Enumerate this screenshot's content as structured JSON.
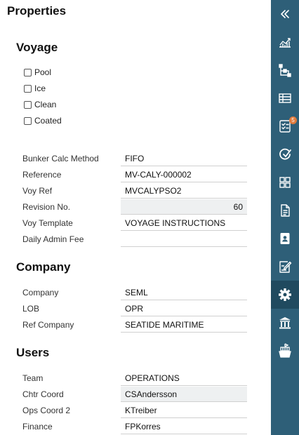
{
  "title": "Properties",
  "voyage": {
    "heading": "Voyage",
    "checkboxes": [
      {
        "label": "Pool",
        "checked": false
      },
      {
        "label": "Ice",
        "checked": false
      },
      {
        "label": "Clean",
        "checked": false
      },
      {
        "label": "Coated",
        "checked": false
      }
    ],
    "fields": [
      {
        "label": "Bunker Calc Method",
        "value": "FIFO"
      },
      {
        "label": "Reference",
        "value": "MV-CALY-000002"
      },
      {
        "label": "Voy Ref",
        "value": "MVCALYPSO2"
      },
      {
        "label": "Revision No.",
        "value": "60"
      },
      {
        "label": "Voy Template",
        "value": "VOYAGE INSTRUCTIONS"
      },
      {
        "label": "Daily Admin Fee",
        "value": ""
      }
    ]
  },
  "company": {
    "heading": "Company",
    "fields": [
      {
        "label": "Company",
        "value": "SEML"
      },
      {
        "label": "LOB",
        "value": "OPR"
      },
      {
        "label": "Ref Company",
        "value": "SEATIDE MARITIME"
      }
    ]
  },
  "users": {
    "heading": "Users",
    "fields": [
      {
        "label": "Team",
        "value": "OPERATIONS"
      },
      {
        "label": "Chtr Coord",
        "value": "CSAndersson"
      },
      {
        "label": "Ops Coord 2",
        "value": "KTreiber"
      },
      {
        "label": "Finance",
        "value": "FPKorres"
      }
    ]
  },
  "sidebar": {
    "background": "#2e5f78",
    "active_color": "#204a5f",
    "badge_color": "#e07a3c",
    "items": [
      {
        "icon": "collapse-icon",
        "active": false
      },
      {
        "icon": "chart-icon",
        "active": false
      },
      {
        "icon": "hierarchy-icon",
        "active": false
      },
      {
        "icon": "table-icon",
        "active": false
      },
      {
        "icon": "checklist-icon",
        "active": false,
        "badge": "5"
      },
      {
        "icon": "speed-check-icon",
        "active": false
      },
      {
        "icon": "grid-icon",
        "active": false
      },
      {
        "icon": "document-icon",
        "active": false
      },
      {
        "icon": "contact-card-icon",
        "active": false
      },
      {
        "icon": "edit-notes-icon",
        "active": false
      },
      {
        "icon": "gear-icon",
        "active": true
      },
      {
        "icon": "bank-icon",
        "active": false
      },
      {
        "icon": "ship-cargo-icon",
        "active": false
      }
    ]
  }
}
